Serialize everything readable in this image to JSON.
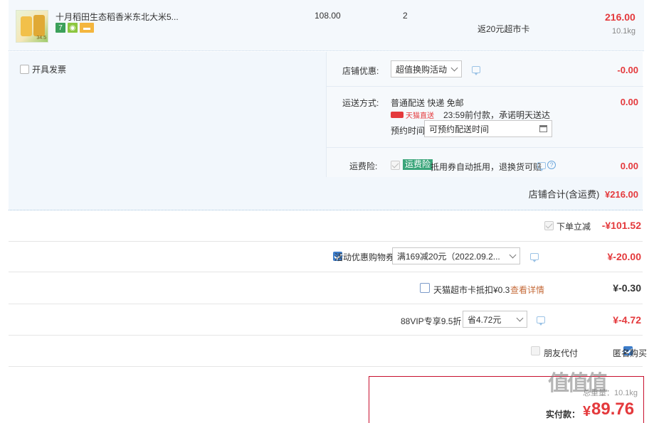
{
  "product": {
    "title": "十月稻田生态稻香米东北大米5...",
    "thumb_tag": "34.5",
    "badge_seven": "7",
    "unit_price": "108.00",
    "quantity": "2",
    "rebate": "返20元超市卡",
    "subtotal": "216.00",
    "weight": "10.1kg"
  },
  "invoice": {
    "label": "开具发票"
  },
  "shop": {
    "promo_label": "店铺优惠:",
    "promo_value": "超值换购活动",
    "promo_amount": "-0.00",
    "shipping_label": "运送方式:",
    "shipping_method": "普通配送 快递 免邮",
    "shipping_amount": "0.00",
    "tmall_tag": "天猫直送",
    "delivery_promise": "23:59前付款，承诺明天送达",
    "schedule_label": "预约时间",
    "schedule_placeholder": "可预约配送时间",
    "insurance_label": "运费险:",
    "insurance_tag": "运费险",
    "insurance_desc": "抵用券自动抵用，退换货可赔",
    "insurance_q": "?",
    "insurance_amount": "0.00",
    "total_label": "店铺合计(含运费)",
    "total_amount": "¥216.00"
  },
  "discounts": {
    "instant_label": "下单立减",
    "instant_amount": "-¥101.52",
    "coupon_label": "活动优惠购物券",
    "coupon_value": "满169减20元（2022.09.2...",
    "coupon_amount": "¥-20.00",
    "supercard_label": "天猫超市卡抵扣¥0.3",
    "supercard_link": "查看详情",
    "supercard_amount": "¥-0.30",
    "vip_label": "88VIP专享9.5折",
    "vip_value": "省4.72元",
    "vip_amount": "¥-4.72",
    "friend_pay_label": "朋友代付",
    "anonymous_label": "匿名购买"
  },
  "payment": {
    "weight_text": "总重量：10.1kg",
    "pay_label": "实付款：",
    "pay_symbol": "¥",
    "pay_amount": "89.76"
  },
  "watermark": "值值值",
  "colors": {
    "accent_red": "#e4393c",
    "check_blue": "#3d7dca",
    "panel_bg": "#f2f7fc"
  }
}
